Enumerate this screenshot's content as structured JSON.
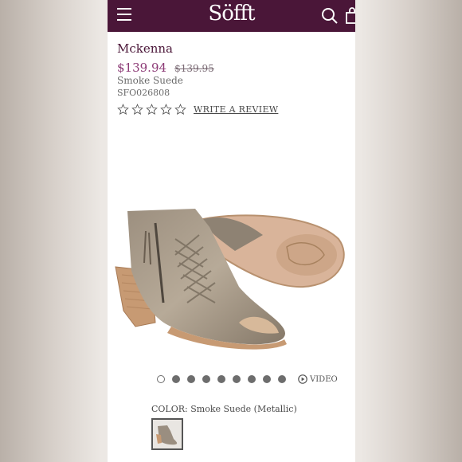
{
  "header": {
    "logo": "Söfft",
    "menu_icon": "hamburger-menu-icon",
    "search_icon": "search-icon",
    "bag_icon": "shopping-bag-icon",
    "brand_color": "#4a1638"
  },
  "product": {
    "name": "Mckenna",
    "price_sale": "$139.94",
    "price_original": "$139.95",
    "color_name": "Smoke Suede",
    "sku": "SFO026808",
    "rating_stars": 0,
    "rating_max": 5,
    "review_link": "WRITE A REVIEW"
  },
  "gallery": {
    "image_count": 9,
    "active_index": 0,
    "video_label": "VIDEO"
  },
  "color_selector": {
    "label": "COLOR: Smoke Suede (Metallic)",
    "swatches": [
      {
        "name": "Smoke Suede (Metallic)",
        "selected": true
      }
    ]
  }
}
